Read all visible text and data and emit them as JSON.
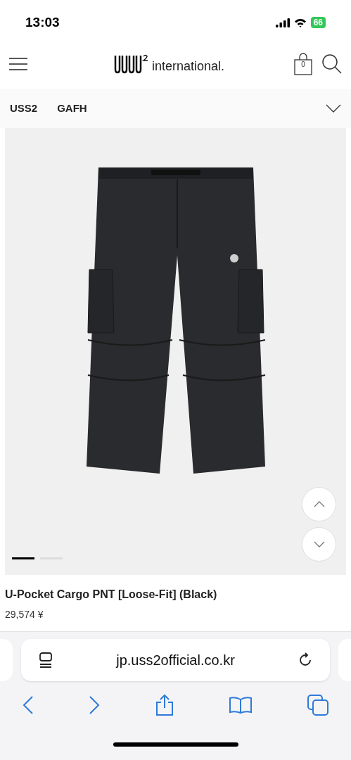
{
  "status_bar": {
    "time": "13:03",
    "battery": "66"
  },
  "header": {
    "logo_text": "international.",
    "cart_count": "0"
  },
  "category_tabs": [
    {
      "label": "USS2"
    },
    {
      "label": "GAFH"
    }
  ],
  "gallery": {
    "slides": [
      {
        "selected": true
      },
      {
        "selected": false
      }
    ]
  },
  "product": {
    "name": "U-Pocket Cargo PNT [Loose-Fit] (Black)",
    "price": "29,574 ¥"
  },
  "browser": {
    "url": "jp.uss2official.co.kr"
  }
}
